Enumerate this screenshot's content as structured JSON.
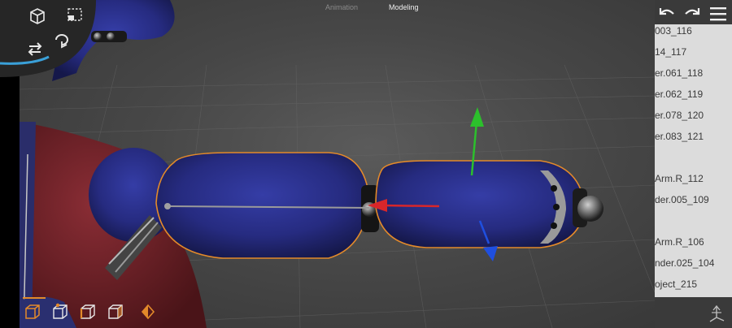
{
  "mode_tabs": [
    {
      "label": "Animation",
      "active": false
    },
    {
      "label": "Modeling",
      "active": true
    }
  ],
  "toolbar": {
    "undo_icon": "undo-icon",
    "redo_icon": "redo-icon",
    "menu_icon": "hamburger-menu-icon"
  },
  "tool_disc": {
    "icons": [
      "cube-view-icon",
      "select-box-icon",
      "move-arrows-icon",
      "rotate-icon"
    ]
  },
  "outliner": {
    "items": [
      "003_116",
      "14_117",
      "er.061_118",
      "er.062_119",
      "er.078_120",
      "er.083_121",
      "",
      "Arm.R_112",
      "der.005_109",
      "",
      "Arm.R_106",
      "nder.025_104",
      "oject_215"
    ]
  },
  "bottom_tools": {
    "icons": [
      "object-mode-icon",
      "vertex-mode-icon",
      "edge-mode-icon",
      "face-mode-icon",
      "keyframe-icon"
    ]
  },
  "colors": {
    "accent": "#e38a2a",
    "gizmo_x": "#d8262a",
    "gizmo_y": "#2cc02c",
    "gizmo_z": "#1f4fe0",
    "mesh_blue": "#2a2f8a"
  }
}
